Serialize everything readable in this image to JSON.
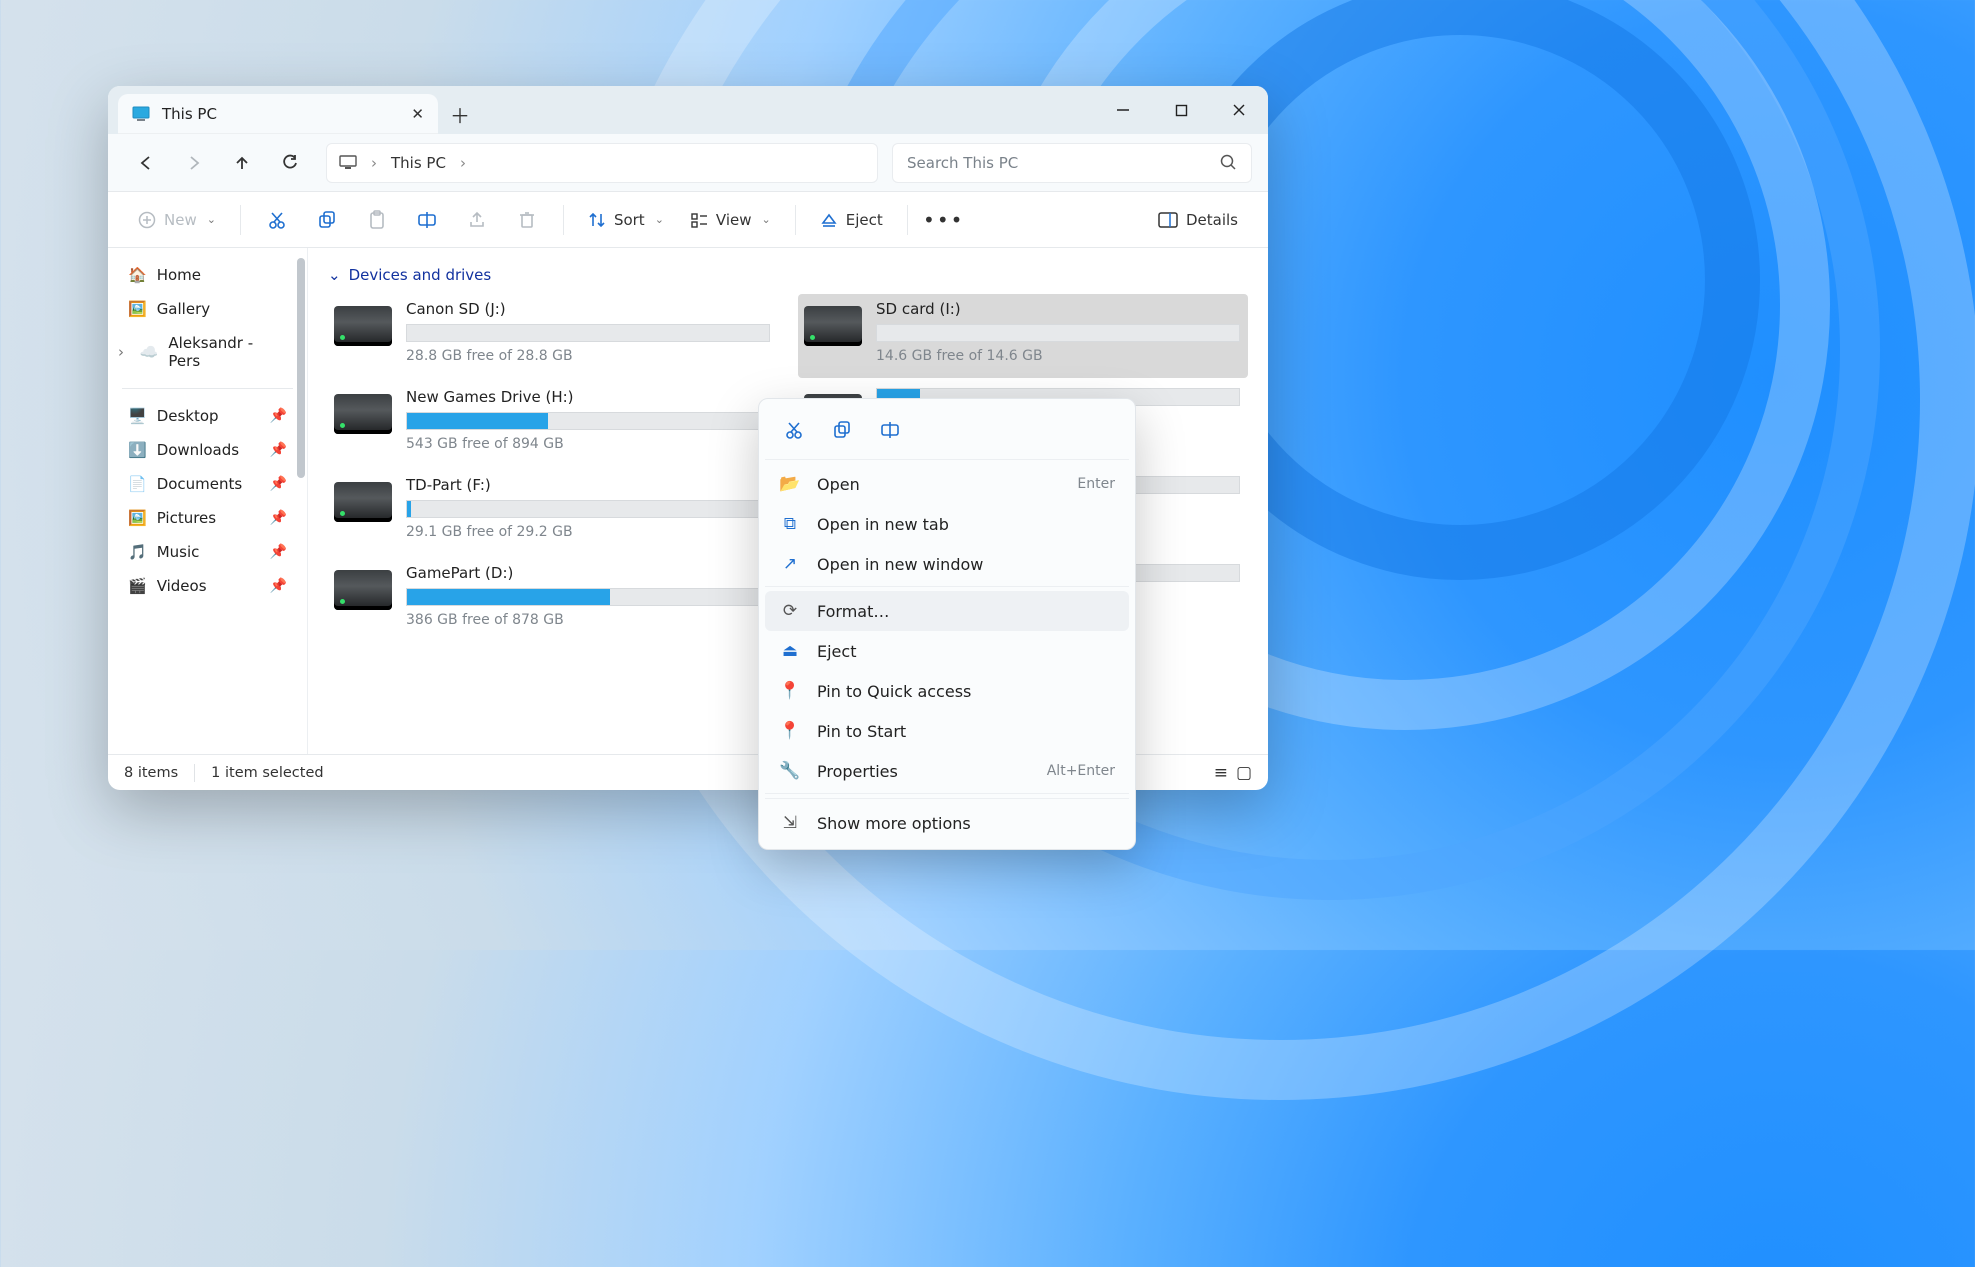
{
  "window": {
    "tab_title": "This PC",
    "new_tab_tooltip": "New tab"
  },
  "nav": {
    "breadcrumb": [
      "This PC"
    ],
    "search_placeholder": "Search This PC"
  },
  "toolbar": {
    "new_label": "New",
    "sort_label": "Sort",
    "view_label": "View",
    "eject_label": "Eject",
    "details_label": "Details"
  },
  "sidebar": {
    "home": "Home",
    "gallery": "Gallery",
    "onedrive": "Aleksandr - Pers",
    "quick": [
      {
        "label": "Desktop"
      },
      {
        "label": "Downloads"
      },
      {
        "label": "Documents"
      },
      {
        "label": "Pictures"
      },
      {
        "label": "Music"
      },
      {
        "label": "Videos"
      }
    ]
  },
  "content": {
    "group_header": "Devices and drives",
    "drives": [
      {
        "name": "Canon SD (J:)",
        "free": "28.8 GB free of 28.8 GB",
        "used_pct": 0,
        "selected": false,
        "col": 0
      },
      {
        "name": "SD card (I:)",
        "free": "14.6 GB free of 14.6 GB",
        "used_pct": 0,
        "selected": true,
        "col": 1
      },
      {
        "name": "New Games Drive (H:)",
        "free": "543 GB free of 894 GB",
        "used_pct": 39,
        "selected": false,
        "col": 0
      },
      {
        "name": "",
        "free": "",
        "used_pct": 12,
        "selected": false,
        "col": 1,
        "partial": true
      },
      {
        "name": "TD-Part (F:)",
        "free": "29.1 GB free of 29.2 GB",
        "used_pct": 1,
        "selected": false,
        "col": 0
      },
      {
        "name": "",
        "free": "",
        "used_pct": 58,
        "selected": false,
        "col": 1,
        "partial": true
      },
      {
        "name": "GamePart (D:)",
        "free": "386 GB free of 878 GB",
        "used_pct": 56,
        "selected": false,
        "col": 0
      },
      {
        "name": "",
        "free": "",
        "used_pct": 0,
        "selected": false,
        "col": 1,
        "partial": true,
        "win": true
      }
    ]
  },
  "statusbar": {
    "count": "8 items",
    "selection": "1 item selected"
  },
  "context_menu": {
    "items": [
      {
        "label": "Open",
        "shortcut": "Enter",
        "icon": "folder"
      },
      {
        "label": "Open in new tab",
        "shortcut": "",
        "icon": "newtab"
      },
      {
        "label": "Open in new window",
        "shortcut": "",
        "icon": "newwin"
      },
      {
        "label": "Format…",
        "shortcut": "",
        "icon": "format",
        "hover": true
      },
      {
        "label": "Eject",
        "shortcut": "",
        "icon": "eject"
      },
      {
        "label": "Pin to Quick access",
        "shortcut": "",
        "icon": "pin"
      },
      {
        "label": "Pin to Start",
        "shortcut": "",
        "icon": "pin"
      },
      {
        "label": "Properties",
        "shortcut": "Alt+Enter",
        "icon": "props"
      },
      {
        "label": "Show more options",
        "shortcut": "",
        "icon": "more"
      }
    ]
  }
}
